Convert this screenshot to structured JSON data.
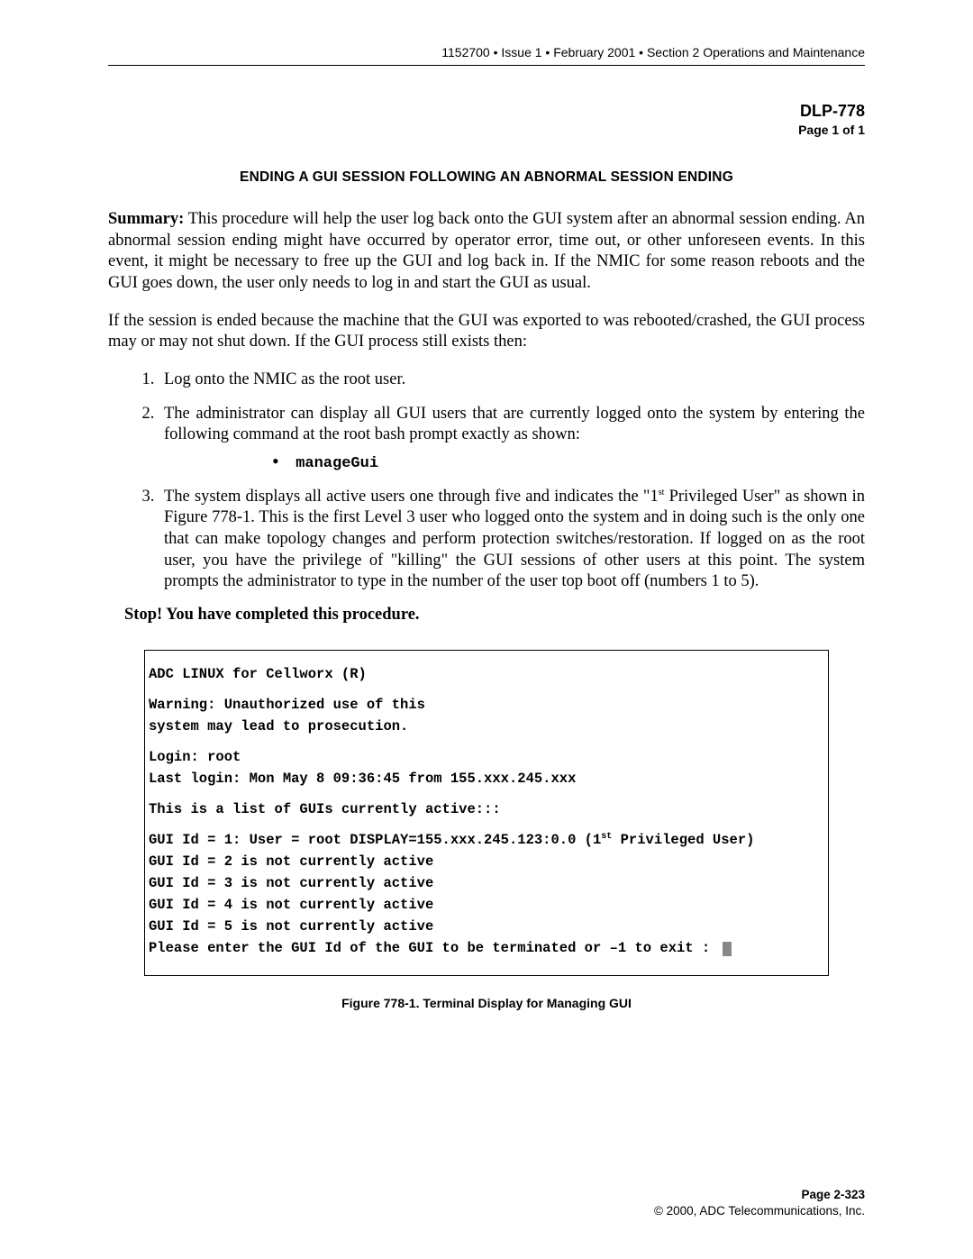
{
  "header": {
    "running": "1152700 • Issue 1 • February 2001 • Section 2 Operations and Maintenance",
    "dlp_code": "DLP-778",
    "dlp_page": "Page 1 of 1"
  },
  "title": "ENDING A GUI SESSION FOLLOWING AN ABNORMAL SESSION ENDING",
  "summary_label": "Summary:",
  "summary_text": " This procedure will help the user log back onto the GUI system after an abnormal session ending. An abnormal session ending might have occurred by operator error, time out, or other unforeseen events. In this event, it might be necessary to free up the GUI and log back in. If the NMIC for some reason reboots and the GUI goes down, the user only needs to log in and start the GUI as usual.",
  "intro2": "If the session is ended because the machine that the GUI was exported to was rebooted/crashed, the GUI process may or may not shut down.  If the GUI process still exists then:",
  "steps": {
    "s1": "Log onto the NMIC as the root user.",
    "s2": "The administrator can display all GUI users that are currently logged onto the system by entering the following command at the root bash prompt exactly as shown:",
    "cmd": "manageGui",
    "s3_a": "The system displays all active users one through five and indicates the \"1",
    "s3_sup": "st",
    "s3_b": " Privileged User\" as shown in Figure 778-1. This is the first Level 3 user who logged onto the system and in doing such is the only one that can make topology changes and perform protection switches/restoration. If logged on as the root user, you have the privilege of \"killing\" the GUI sessions of other users at this point. The system prompts the administrator to type in the number of the user top boot off (numbers 1 to 5)."
  },
  "stop_line": "Stop! You have completed this procedure.",
  "terminal": {
    "l1": "ADC LINUX for Cellworx (R)",
    "l2": "Warning: Unauthorized use of this",
    "l3": "system may lead to prosecution.",
    "l4": "Login: root",
    "l5": "Last login: Mon May 8 09:36:45 from 155.xxx.245.xxx",
    "l6": "This is a list of GUIs currently active:::",
    "l7a": "GUI Id = 1: User = root DISPLAY=155.xxx.245.123:0.0 (1",
    "l7sup": "st",
    "l7b": " Privileged User)",
    "l8": "GUI Id = 2 is not currently active",
    "l9": "GUI Id = 3 is not currently active",
    "l10": "GUI Id = 4 is not currently active",
    "l11": "GUI Id = 5 is not currently active",
    "l12": "Please enter the GUI Id of the GUI to be terminated or –1 to exit : "
  },
  "figure_caption": "Figure 778-1. Terminal Display for Managing GUI",
  "footer": {
    "page": "Page 2-323",
    "copyright": "© 2000, ADC Telecommunications, Inc."
  }
}
